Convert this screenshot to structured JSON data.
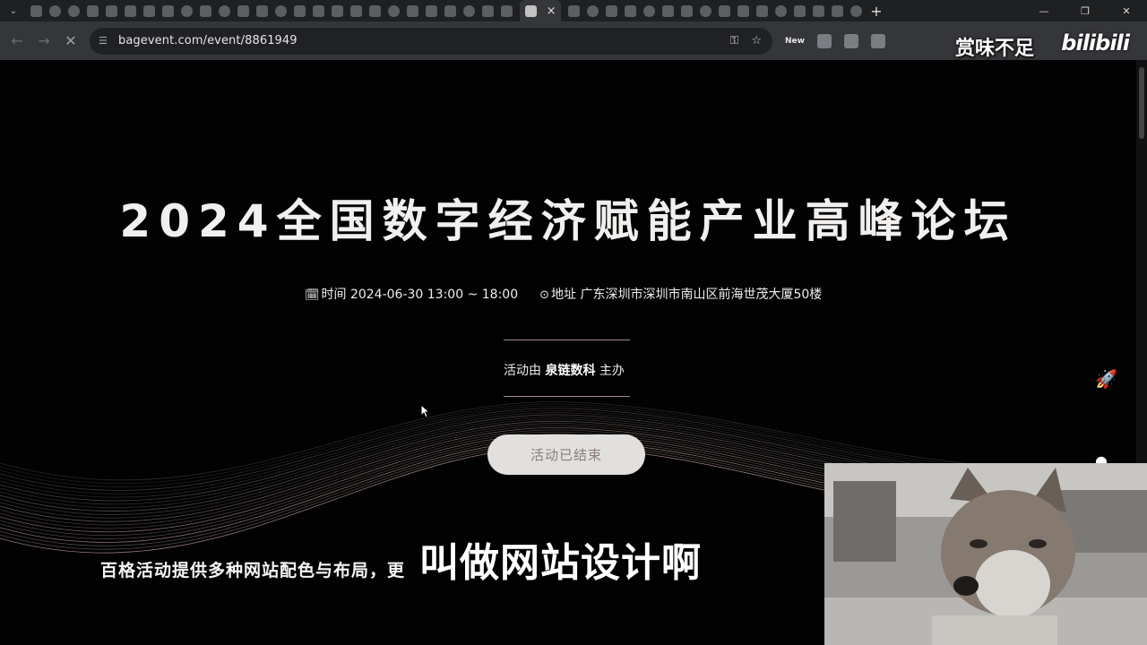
{
  "browser": {
    "url": "bagevent.com/event/8861949",
    "new_badge": "New"
  },
  "overlay": {
    "slogan": "赏味不足",
    "logo_text": "bilibili",
    "subtitle": "叫做网站设计啊"
  },
  "event": {
    "title": "2024全国数字经济赋能产业高峰论坛",
    "time_label": "时间 2024-06-30 13:00 ~ 18:00",
    "address_label": "地址 广东深圳市深圳市南山区前海世茂大厦50楼",
    "organizer_prefix": "活动由",
    "organizer_name": "泉链数科",
    "organizer_suffix": "主办",
    "status_button": "活动已结束"
  },
  "promo": {
    "text": "百格活动提供多种网站配色与布局，更"
  },
  "colors": {
    "page_background": "#020202",
    "button_background": "#e2e0de",
    "button_text": "#8a7e7b",
    "divider": "#a08c86"
  },
  "icons": [
    "calendar-icon",
    "location-pin-icon",
    "rocket-icon",
    "chat-icon",
    "reload-icon",
    "star-icon",
    "key-icon"
  ]
}
